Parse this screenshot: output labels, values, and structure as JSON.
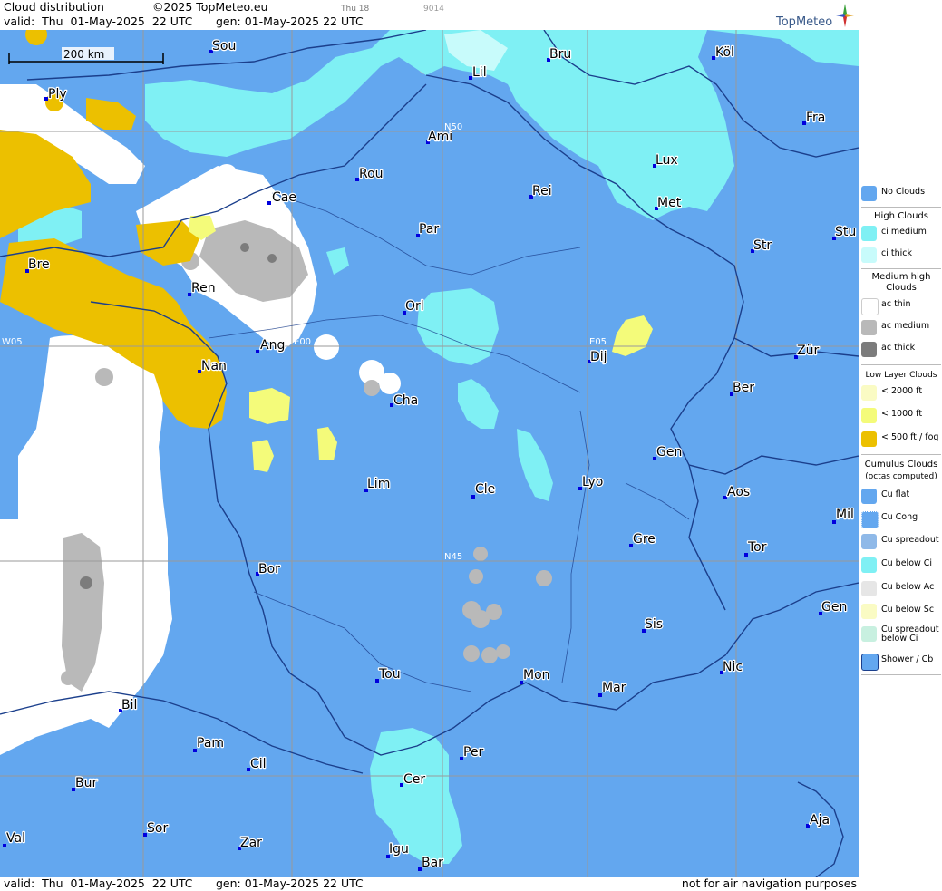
{
  "header": {
    "title": "Cloud distribution",
    "copyright": "©2025 TopMeteo.eu",
    "day_tag": "Thu 18",
    "code": "9014",
    "valid_label": "valid:  Thu  01-May-2025  22 UTC",
    "gen_label": "gen: 01-May-2025 22 UTC",
    "logo_text": "TopMeteo"
  },
  "footer": {
    "valid_label": "valid:  Thu  01-May-2025  22 UTC",
    "gen_label": "gen: 01-May-2025 22 UTC",
    "disclaimer": "not for air navigation purposes"
  },
  "map": {
    "scale_label": "200 km",
    "grid_labels": [
      "W05",
      "E00",
      "E05",
      "N50",
      "N45"
    ],
    "cities": [
      "Sou",
      "Bru",
      "Köl",
      "Ply",
      "Lil",
      "Ami",
      "Fra",
      "Rou",
      "Lux",
      "Cae",
      "Rei",
      "Met",
      "Par",
      "Stu",
      "Str",
      "Bre",
      "Ren",
      "Orl",
      "Ang",
      "Dij",
      "Zür",
      "Nan",
      "Ber",
      "Cha",
      "Gen",
      "Lim",
      "Cle",
      "Lyo",
      "Aos",
      "Mil",
      "Gre",
      "Tor",
      "Bor",
      "Gen",
      "Sis",
      "Nic",
      "Tou",
      "Mon",
      "Mar",
      "Bil",
      "Pam",
      "Cil",
      "Per",
      "Bur",
      "Cer",
      "Sor",
      "Aja",
      "Val",
      "Zar",
      "Igu",
      "Bar"
    ],
    "colors": {
      "no_clouds": "#63a7ef",
      "ci_medium": "#7ff0f4",
      "ci_thick": "#c8fbfb",
      "ac_thin": "#ffffff",
      "ac_medium": "#b9b9b9",
      "ac_thick": "#7c7c7c",
      "low_2000": "#fafbc4",
      "low_1000": "#f4fb7a",
      "low_500": "#ecc000",
      "border": "#1b3f8c"
    }
  },
  "legend": {
    "no_clouds": "No Clouds",
    "high_clouds": "High Clouds",
    "ci_medium": "ci medium",
    "ci_thick": "ci thick",
    "medium_high": "Medium high Clouds",
    "ac_thin": "ac thin",
    "ac_medium": "ac medium",
    "ac_thick": "ac thick",
    "low_layer": "Low Layer Clouds",
    "low_2000": "< 2000 ft",
    "low_1000": "< 1000 ft",
    "low_500": "< 500 ft / fog",
    "cumulus": "Cumulus Clouds",
    "cumulus_sub": "(octas computed)",
    "cu_flat": "Cu flat",
    "cu_cong": "Cu Cong",
    "cu_spreadout": "Cu spreadout",
    "cu_below_ci": "Cu below Ci",
    "cu_below_ac": "Cu below Ac",
    "cu_below_sc": "Cu below Sc",
    "cu_spreadout_below_ci": "Cu spreadout below Ci",
    "shower": "Shower / Cb"
  }
}
